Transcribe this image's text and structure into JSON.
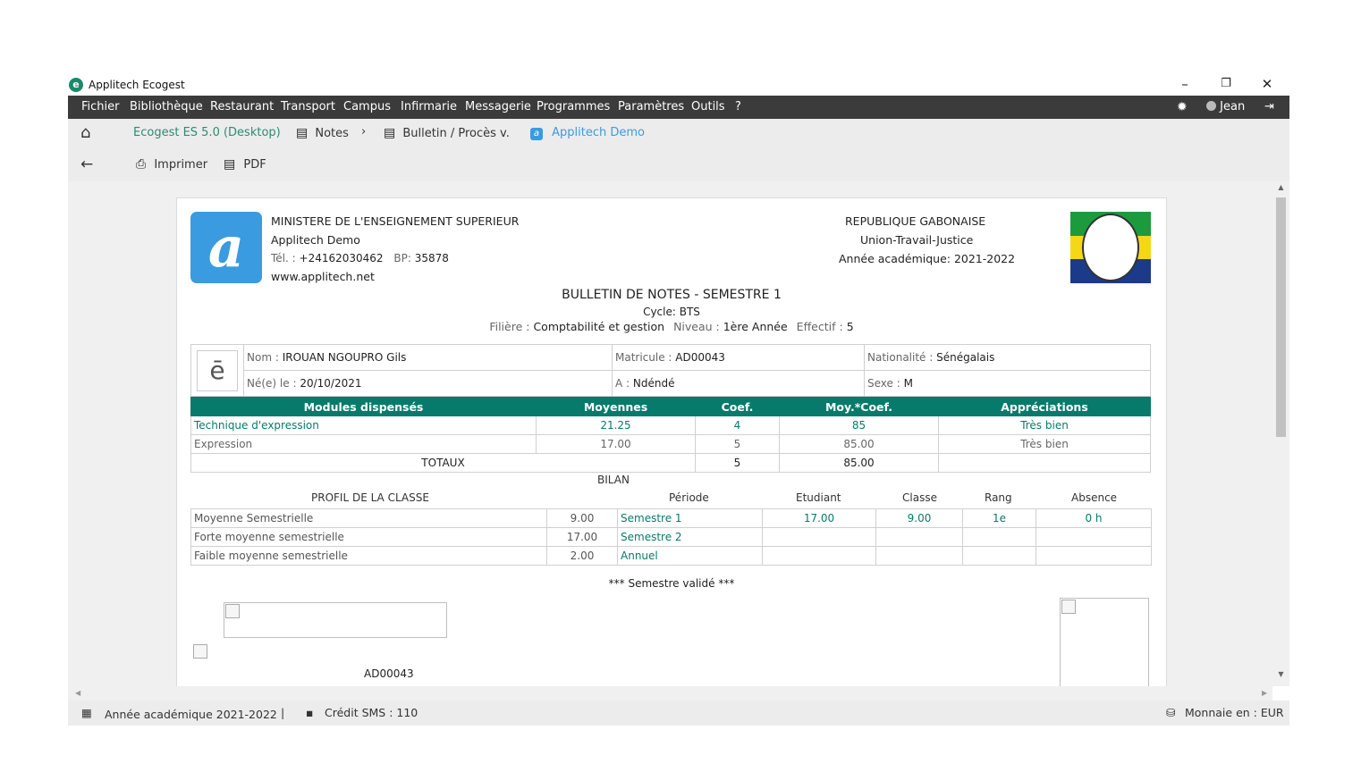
{
  "window": {
    "title": "Applitech Ecogest",
    "app_icon": "app-logo-icon",
    "minimize": "–",
    "maximize": "❐",
    "close": "✕"
  },
  "menu": [
    "Fichier",
    "Bibliothèque",
    "Restaurant",
    "Transport",
    "Campus",
    "Infirmarie",
    "Messagerie",
    "Programmes",
    "Paramètres",
    "Outils",
    "?"
  ],
  "user": {
    "name": "Jean"
  },
  "toolbar": {
    "app_link": "Ecogest ES 5.0 (Desktop)",
    "crumb_notes": "Notes",
    "crumb_sep": "›",
    "crumb_bulletin": "Bulletin / Procès v.",
    "school_link": "Applitech Demo",
    "print": "Imprimer",
    "pdf": "PDF"
  },
  "doc": {
    "ministry": "MINISTERE DE L'ENSEIGNEMENT SUPERIEUR",
    "school": "Applitech Demo",
    "tel_label": "Tél. :",
    "tel": "+24162030462",
    "bp_label": "BP:",
    "bp": "35878",
    "website": "www.applitech.net",
    "republic": "REPUBLIQUE GABONAISE",
    "motto": "Union-Travail-Justice",
    "academic_year": "Année académique: 2021-2022",
    "title": "BULLETIN DE NOTES - SEMESTRE 1",
    "cycle": "Cycle: BTS",
    "filiere_label": "Filière :",
    "filiere": "Comptabilité et gestion",
    "niveau_label": "Niveau :",
    "niveau": "1ère Année",
    "effectif_label": "Effectif :",
    "effectif": "5",
    "student": {
      "nom_label": "Nom :",
      "nom": "IROUAN NGOUPRO Gils",
      "matricule_label": "Matricule :",
      "matricule": "AD00043",
      "nationalite_label": "Nationalité :",
      "nationalite": "Sénégalais",
      "ne_label": "Né(e) le :",
      "ne": "20/10/2021",
      "a_label": "A :",
      "a": "Ndéndé",
      "sexe_label": "Sexe :",
      "sexe": "M"
    },
    "modules": {
      "headers": [
        "Modules dispensés",
        "Moyennes",
        "Coef.",
        "Moy.*Coef.",
        "Appréciations"
      ],
      "rows": [
        [
          "Technique d'expression",
          "21.25",
          "4",
          "85",
          "Très bien"
        ],
        [
          "Expression",
          "17.00",
          "5",
          "85.00",
          "Très bien"
        ]
      ],
      "totals": [
        "TOTAUX",
        "5",
        "85.00",
        ""
      ]
    },
    "bilan": {
      "title": "BILAN",
      "profil_title": "PROFIL DE LA CLASSE",
      "headers": [
        "Période",
        "Etudiant",
        "Classe",
        "Rang",
        "Absence"
      ],
      "profil": [
        [
          "Moyenne Semestrielle",
          "9.00"
        ],
        [
          "Forte moyenne semestrielle",
          "17.00"
        ],
        [
          "Faible moyenne semestrielle",
          "2.00"
        ]
      ],
      "periods": [
        [
          "Semestre 1",
          "17.00",
          "9.00",
          "1e",
          "0 h"
        ],
        [
          "Semestre 2",
          "",
          "",
          "",
          ""
        ],
        [
          "Annuel",
          "",
          "",
          "",
          ""
        ]
      ]
    },
    "decision": "*** Semestre validé ***",
    "barcode_text": "AD00043"
  },
  "status": {
    "year": "Année académique 2021-2022",
    "sep": "|",
    "sms": "Crédit SMS : 110",
    "currency": "Monnaie en : EUR"
  },
  "colors": {
    "teal": "#077a6b",
    "menubar": "#3b3b3b",
    "blue": "#3a9be0"
  }
}
